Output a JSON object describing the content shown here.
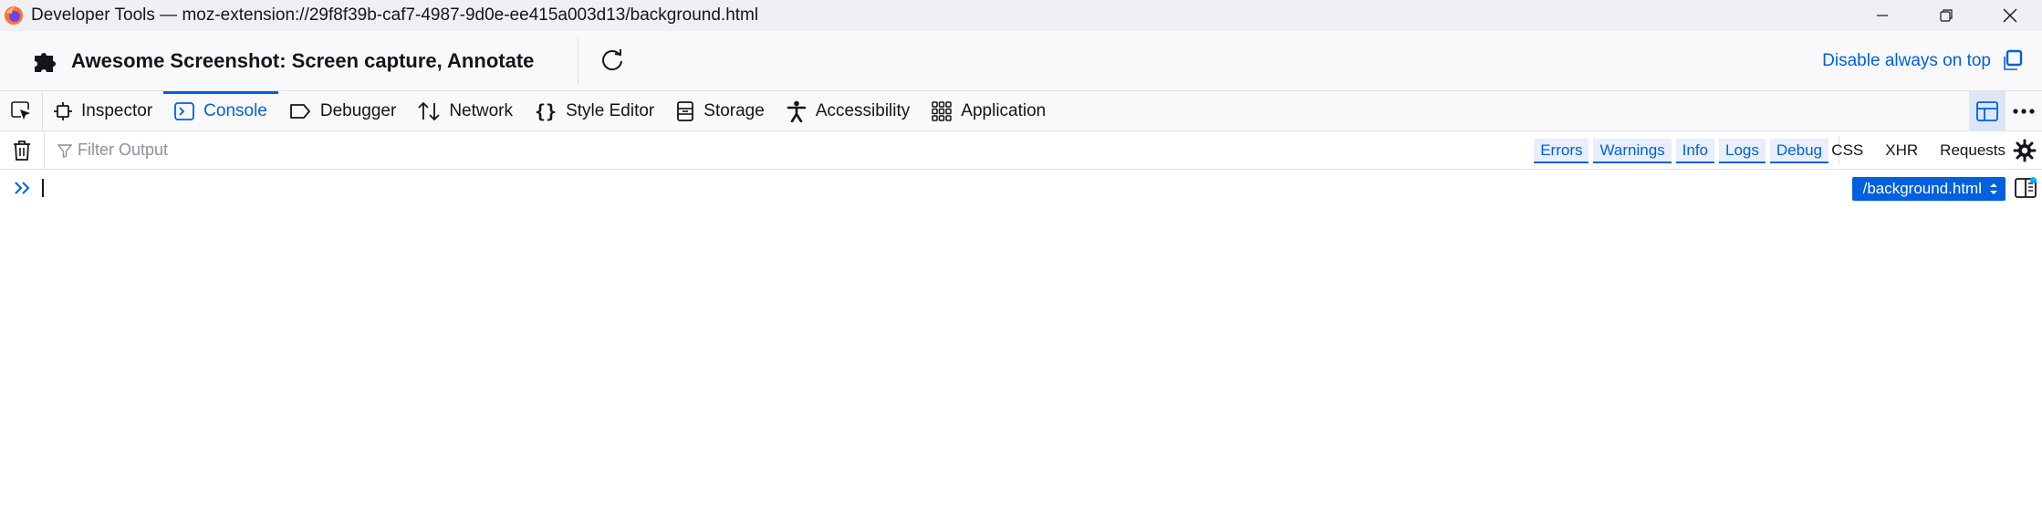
{
  "window": {
    "title": "Developer Tools — moz-extension://29f8f39b-caf7-4987-9d0e-ee415a003d13/background.html"
  },
  "extension": {
    "title": "Awesome Screenshot: Screen capture, Annotate",
    "always_on_top_label": "Disable always on top"
  },
  "tabs": [
    {
      "label": "Inspector",
      "icon": "inspector-icon"
    },
    {
      "label": "Console",
      "icon": "console-icon",
      "active": true
    },
    {
      "label": "Debugger",
      "icon": "debugger-icon"
    },
    {
      "label": "Network",
      "icon": "network-icon"
    },
    {
      "label": "Style Editor",
      "icon": "style-editor-icon"
    },
    {
      "label": "Storage",
      "icon": "storage-icon"
    },
    {
      "label": "Accessibility",
      "icon": "accessibility-icon"
    },
    {
      "label": "Application",
      "icon": "application-icon"
    }
  ],
  "filter": {
    "placeholder": "Filter Output",
    "levels": [
      "Errors",
      "Warnings",
      "Info",
      "Logs",
      "Debug"
    ],
    "requests": [
      "CSS",
      "XHR",
      "Requests"
    ]
  },
  "console": {
    "context_selector": "/background.html"
  },
  "colors": {
    "accent": "#0060df",
    "titlebar": "#f0f0f4",
    "toolbar": "#f9f9fb"
  }
}
